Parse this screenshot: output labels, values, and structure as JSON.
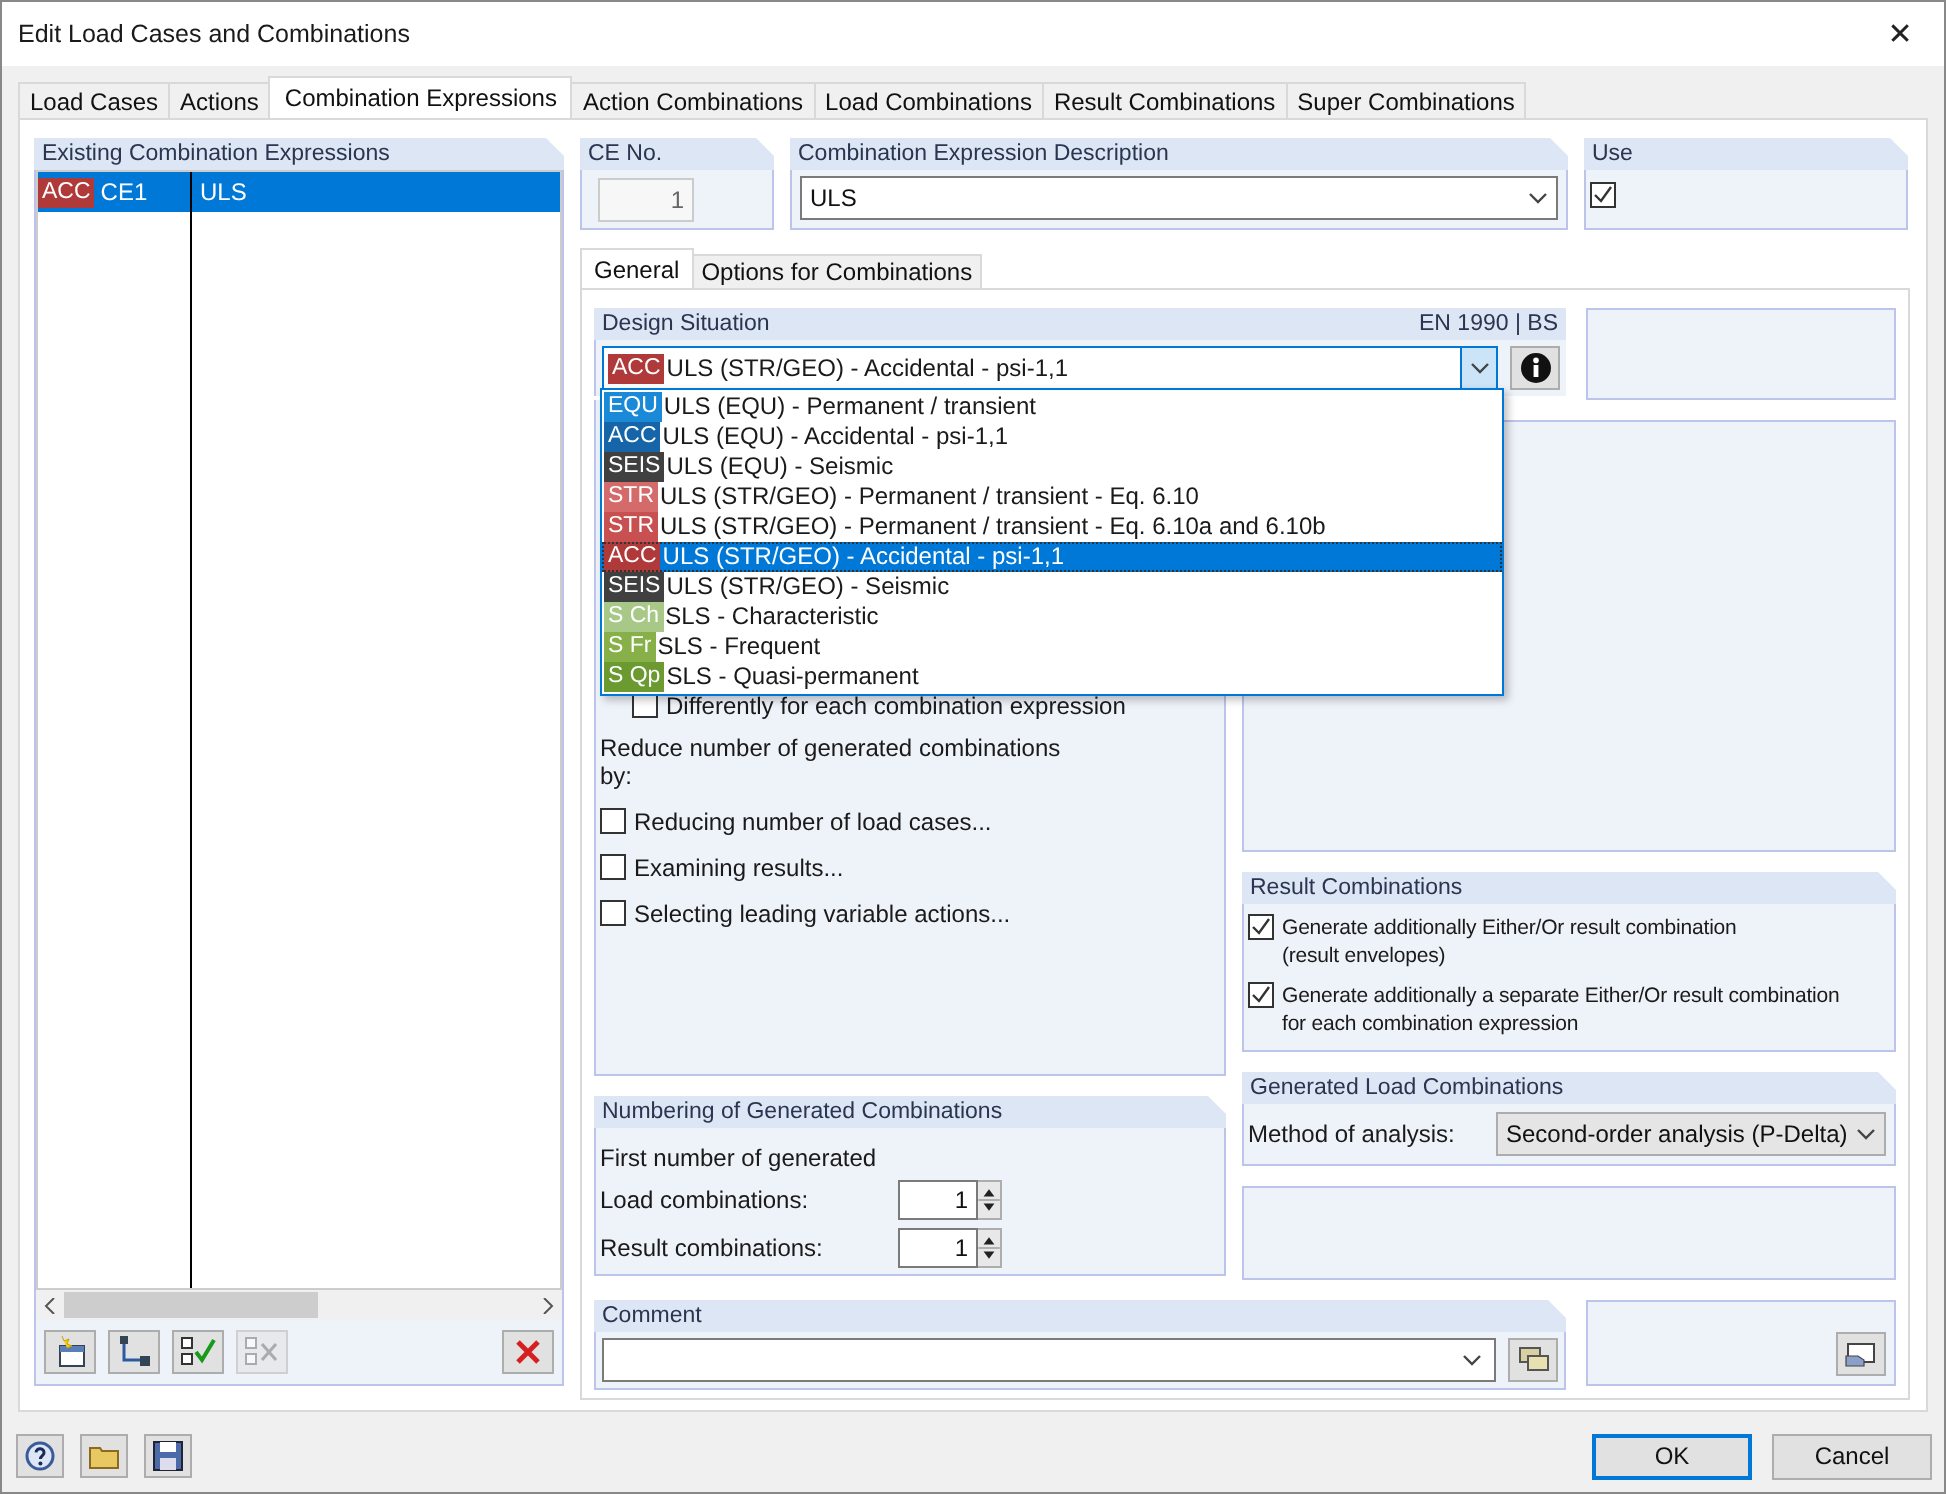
{
  "window": {
    "title": "Edit Load Cases and Combinations",
    "close": "✕"
  },
  "tabs": [
    {
      "label": "Load Cases",
      "selected": false
    },
    {
      "label": "Actions",
      "selected": false
    },
    {
      "label": "Combination Expressions",
      "selected": true
    },
    {
      "label": "Action Combinations",
      "selected": false
    },
    {
      "label": "Load Combinations",
      "selected": false
    },
    {
      "label": "Result Combinations",
      "selected": false
    },
    {
      "label": "Super Combinations",
      "selected": false
    }
  ],
  "existing": {
    "title": "Existing Combination Expressions",
    "rows": [
      {
        "badge": "ACC",
        "color": "#b03a3a",
        "ce": "CE1",
        "description": "ULS",
        "selected": true
      }
    ]
  },
  "ce_no": {
    "label": "CE No.",
    "value": "1"
  },
  "description": {
    "label": "Combination Expression Description",
    "value": "ULS"
  },
  "use": {
    "label": "Use",
    "checked": true
  },
  "subtabs": [
    {
      "label": "General",
      "selected": true
    },
    {
      "label": "Options for Combinations",
      "selected": false
    }
  ],
  "design_situation": {
    "label": "Design Situation",
    "standard": "EN 1990 | BS",
    "value": {
      "badge": "ACC",
      "color": "#b03a3a",
      "text": "ULS (STR/GEO) - Accidental - psi-1,1"
    },
    "options": [
      {
        "badge": "EQU",
        "color": "#1a8ad8",
        "text": "ULS (EQU) - Permanent / transient",
        "selected": false
      },
      {
        "badge": "ACC",
        "color": "#1565a8",
        "text": "ULS (EQU) - Accidental - psi-1,1",
        "selected": false
      },
      {
        "badge": "SEIS",
        "color": "#404040",
        "text": "ULS (EQU) - Seismic",
        "selected": false
      },
      {
        "badge": "STR",
        "color": "#d46a6a",
        "text": "ULS (STR/GEO) - Permanent / transient - Eq. 6.10",
        "selected": false
      },
      {
        "badge": "STR",
        "color": "#c85050",
        "text": "ULS (STR/GEO) - Permanent / transient - Eq. 6.10a and 6.10b",
        "selected": false
      },
      {
        "badge": "ACC",
        "color": "#b03a3a",
        "text": "ULS (STR/GEO) - Accidental - psi-1,1",
        "selected": true
      },
      {
        "badge": "SEIS",
        "color": "#404040",
        "text": "ULS (STR/GEO) - Seismic",
        "selected": false
      },
      {
        "badge": "S Ch",
        "color": "#a8c888",
        "text": "SLS - Characteristic",
        "selected": false
      },
      {
        "badge": "S Fr",
        "color": "#88b048",
        "text": "SLS - Frequent",
        "selected": false
      },
      {
        "badge": "S Qp",
        "color": "#6a9a30",
        "text": "SLS - Quasi-permanent",
        "selected": false
      }
    ]
  },
  "covered_option": {
    "label": "Differently for each combination expression",
    "checked": false
  },
  "reduce": {
    "heading": "Reduce number of generated combinations\nby:",
    "options": [
      {
        "label": "Reducing number of load cases...",
        "checked": false
      },
      {
        "label": "Examining results...",
        "checked": false
      },
      {
        "label": "Selecting leading variable actions...",
        "checked": false
      }
    ]
  },
  "numbering": {
    "title": "Numbering of Generated Combinations",
    "intro": "First number of generated",
    "fields": [
      {
        "label": "Load combinations:",
        "value": "1"
      },
      {
        "label": "Result combinations:",
        "value": "1"
      }
    ]
  },
  "result_combinations": {
    "title": "Result Combinations",
    "options": [
      {
        "label": "Generate additionally Either/Or result combination\n(result envelopes)",
        "checked": true
      },
      {
        "label": "Generate additionally a separate Either/Or result combination\nfor each combination expression",
        "checked": true
      }
    ]
  },
  "generated": {
    "title": "Generated Load Combinations",
    "label": "Method of analysis:",
    "value": "Second-order analysis (P-Delta)"
  },
  "comment": {
    "label": "Comment"
  },
  "buttons": [
    {
      "label": "OK",
      "default": true
    },
    {
      "label": "Cancel",
      "default": false
    }
  ]
}
